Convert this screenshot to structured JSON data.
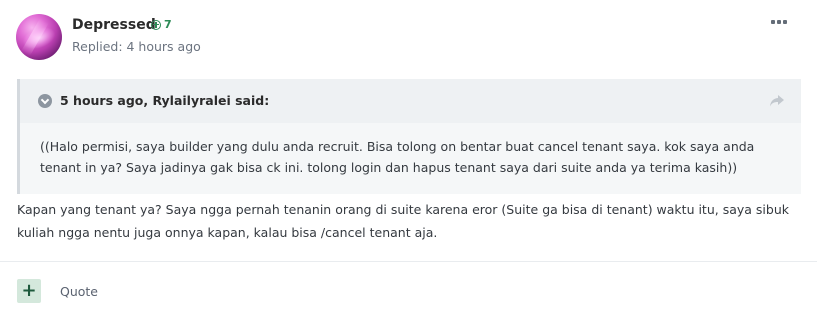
{
  "post": {
    "author": "Depressed",
    "reputation": "7",
    "replied": "Replied: 4 hours ago",
    "colors": {
      "reputation": "#2c8a56",
      "quote_bg": "#f5f7f8",
      "plus_button_bg": "#d4e8dc"
    }
  },
  "quote": {
    "citation": "5 hours ago, Rylailyralei said:",
    "text": "((Halo permisi, saya builder yang dulu anda recruit. Bisa tolong on bentar buat cancel tenant saya. kok saya anda tenant in ya? Saya jadinya gak bisa ck ini. tolong login dan hapus tenant saya dari suite anda ya terima kasih))"
  },
  "body": {
    "text": "Kapan yang tenant ya? Saya ngga pernah tenanin orang di suite karena eror (Suite ga bisa di tenant) waktu itu, saya sibuk kuliah ngga nentu juga onnya kapan, kalau bisa /cancel tenant aja."
  },
  "actions": {
    "plus_label": "+",
    "quote_label": "Quote"
  },
  "icons": {
    "avatar": "avatar-image",
    "reputation": "plus-circle-icon",
    "more": "more-horizontal-icon",
    "toggle": "chevron-down-circle-icon",
    "share": "share-arrow-icon"
  }
}
